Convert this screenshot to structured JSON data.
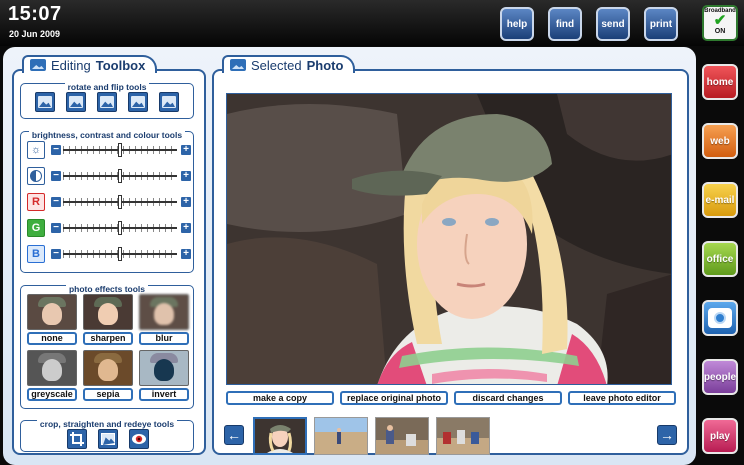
{
  "status": {
    "time": "15:07",
    "date": "20 Jun 2009"
  },
  "toolbar": {
    "help": "help",
    "find": "find",
    "send": "send",
    "print": "print"
  },
  "broadband": {
    "label": "Broadband",
    "state": "ON"
  },
  "left_panel": {
    "title_light": "Editing ",
    "title_bold": "Toolbox",
    "rotate_title": "rotate and flip tools",
    "bcc_title": "brightness, contrast and colour tools",
    "sliders": [
      {
        "label": "",
        "icon": "brightness-sun-icon",
        "value": 0.5
      },
      {
        "label": "",
        "icon": "contrast-icon",
        "value": 0.5
      },
      {
        "label": "R",
        "color": "#d42a2a",
        "value": 0.5
      },
      {
        "label": "G",
        "color": "#2aa12a",
        "value": 0.5
      },
      {
        "label": "B",
        "color": "#2a6fd4",
        "value": 0.5
      }
    ],
    "effects_title": "photo effects tools",
    "effects": [
      "none",
      "sharpen",
      "blur",
      "greyscale",
      "sepia",
      "invert"
    ],
    "crop_title": "crop, straighten and redeye tools"
  },
  "right_panel": {
    "title_light": "Selected ",
    "title_bold": "Photo",
    "actions": [
      "make a copy",
      "replace original photo",
      "discard changes",
      "leave photo editor"
    ]
  },
  "nav": [
    {
      "label": "home",
      "color": "#d8262b"
    },
    {
      "label": "web",
      "color": "#e9761f"
    },
    {
      "label": "e-mail",
      "color": "#eeb417"
    },
    {
      "label": "office",
      "color": "#7fb72a"
    },
    {
      "label": "",
      "color": "#2f7fd0",
      "icon": "camera-icon"
    },
    {
      "label": "people",
      "color": "#9b5fb8"
    },
    {
      "label": "play",
      "color": "#d42f6c"
    }
  ]
}
